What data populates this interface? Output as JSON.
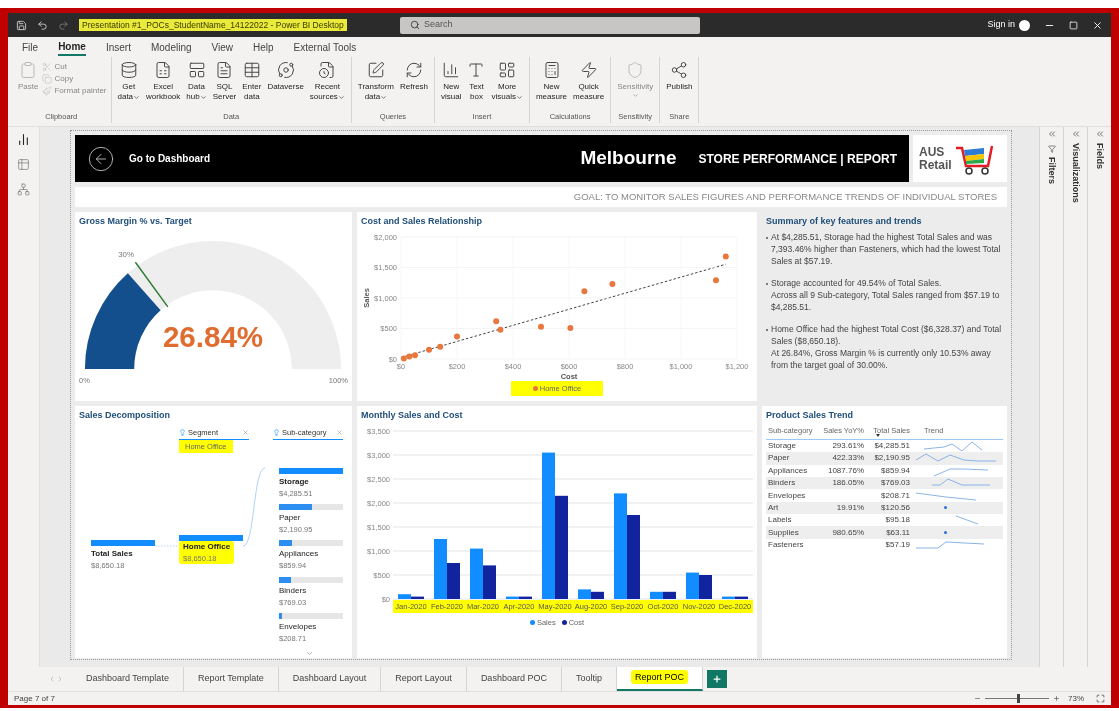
{
  "window": {
    "title": "Presentation #1_POCs_StudentName_14122022 - Power BI Desktop",
    "title_highlighted": true,
    "search": {
      "placeholder": "Search"
    },
    "sign_in": "Sign in"
  },
  "menu_tabs": [
    {
      "label": "File",
      "selected": false
    },
    {
      "label": "Home",
      "selected": true
    },
    {
      "label": "Insert",
      "selected": false
    },
    {
      "label": "Modeling",
      "selected": false
    },
    {
      "label": "View",
      "selected": false
    },
    {
      "label": "Help",
      "selected": false
    },
    {
      "label": "External Tools",
      "selected": false
    }
  ],
  "ribbon": [
    {
      "name": "Clipboard",
      "items": [
        {
          "kind": "large",
          "lines": [
            "Paste"
          ],
          "dropdown": false,
          "disabled": true
        },
        {
          "kind": "small",
          "lines": [
            "Cut"
          ],
          "dropdown": false,
          "disabled": true
        },
        {
          "kind": "small",
          "lines": [
            "Copy"
          ],
          "dropdown": false,
          "disabled": true
        },
        {
          "kind": "small",
          "lines": [
            "Format painter"
          ],
          "dropdown": false,
          "disabled": true
        }
      ]
    },
    {
      "name": "Data",
      "items": [
        {
          "kind": "large",
          "lines": [
            "Get",
            "data"
          ],
          "dropdown": true,
          "disabled": false
        },
        {
          "kind": "large",
          "lines": [
            "Excel",
            "workbook"
          ],
          "dropdown": false,
          "disabled": false
        },
        {
          "kind": "large",
          "lines": [
            "Data",
            "hub"
          ],
          "dropdown": true,
          "disabled": false
        },
        {
          "kind": "large",
          "lines": [
            "SQL",
            "Server"
          ],
          "dropdown": false,
          "disabled": false
        },
        {
          "kind": "large",
          "lines": [
            "Enter",
            "data"
          ],
          "dropdown": false,
          "disabled": false
        },
        {
          "kind": "large",
          "lines": [
            "Dataverse"
          ],
          "dropdown": false,
          "disabled": false
        },
        {
          "kind": "large",
          "lines": [
            "Recent",
            "sources"
          ],
          "dropdown": true,
          "disabled": false
        }
      ]
    },
    {
      "name": "Queries",
      "items": [
        {
          "kind": "large",
          "lines": [
            "Transform",
            "data"
          ],
          "dropdown": true,
          "disabled": false
        },
        {
          "kind": "large",
          "lines": [
            "Refresh"
          ],
          "dropdown": false,
          "disabled": false
        }
      ]
    },
    {
      "name": "Insert",
      "items": [
        {
          "kind": "large",
          "lines": [
            "New",
            "visual"
          ],
          "dropdown": false,
          "disabled": false
        },
        {
          "kind": "large",
          "lines": [
            "Text",
            "box"
          ],
          "dropdown": false,
          "disabled": false
        },
        {
          "kind": "large",
          "lines": [
            "More",
            "visuals"
          ],
          "dropdown": true,
          "disabled": false
        }
      ]
    },
    {
      "name": "Calculations",
      "items": [
        {
          "kind": "large",
          "lines": [
            "New",
            "measure"
          ],
          "dropdown": false,
          "disabled": false
        },
        {
          "kind": "large",
          "lines": [
            "Quick",
            "measure"
          ],
          "dropdown": false,
          "disabled": false
        }
      ]
    },
    {
      "name": "Sensitivity",
      "items": [
        {
          "kind": "large",
          "lines": [
            "Sensitivity"
          ],
          "dropdown": true,
          "disabled": true
        }
      ]
    },
    {
      "name": "Share",
      "items": [
        {
          "kind": "large",
          "lines": [
            "Publish"
          ],
          "dropdown": false,
          "disabled": false
        }
      ]
    }
  ],
  "left_rail": [
    {
      "selected": true
    },
    {
      "selected": false
    },
    {
      "selected": false
    }
  ],
  "header": {
    "back_label": "Go to Dashboard",
    "city": "Melbourne",
    "subtitle": "STORE PERFORMANCE | REPORT",
    "logo_lines": [
      "AUS",
      "Retail"
    ]
  },
  "goal": "GOAL: TO MONITOR SALES FIGURES AND PERFORMANCE TRENDS OF INDIVIDUAL STORES",
  "gauge": {
    "title": "Gross Margin % vs. Target",
    "value": "26.84%",
    "target_label": "30%",
    "min": "0%",
    "max": "100%"
  },
  "scatter": {
    "title": "Cost and Sales Relationship",
    "legend": {
      "highlighted": true
    },
    "chart_data": {
      "type": "scatter",
      "xlabel": "Cost",
      "ylabel": "Sales",
      "xlim": [
        0,
        1200
      ],
      "ylim": [
        0,
        2000
      ],
      "grid": true,
      "xticks": [
        {
          "value": 0,
          "label": "$0"
        },
        {
          "value": 200,
          "label": "$200"
        },
        {
          "value": 400,
          "label": "$400"
        },
        {
          "value": 600,
          "label": "$600"
        },
        {
          "value": 800,
          "label": "$800"
        },
        {
          "value": 1000,
          "label": "$1,000"
        },
        {
          "value": 1200,
          "label": "$1,200"
        }
      ],
      "yticks": [
        {
          "value": 0,
          "label": "$0"
        },
        {
          "value": 500,
          "label": "$500"
        },
        {
          "value": 1000,
          "label": "$1,000"
        },
        {
          "value": 1500,
          "label": "$1,500"
        },
        {
          "value": 2000,
          "label": "$2,000"
        }
      ],
      "x": [
        10,
        30,
        50,
        100,
        140,
        200,
        340,
        355,
        500,
        605,
        655,
        755,
        1125,
        1160
      ],
      "series": [
        {
          "name": "Home Office",
          "color": "#e8773d",
          "values": [
            10,
            40,
            60,
            150,
            200,
            370,
            620,
            480,
            530,
            510,
            1110,
            1230,
            1290,
            1680
          ]
        }
      ]
    }
  },
  "summary": {
    "title": "Summary of key features and trends",
    "bullets": [
      {
        "lines": [
          "At $4,285.51, Storage had the highest Total Sales and was 7,393.46% higher than Fasteners, which had the lowest Total Sales at $57.19."
        ]
      },
      {
        "lines": [
          "Storage accounted for 49.54% of Total Sales.",
          "Across all 9 Sub-category, Total Sales ranged from $57.19 to $4,285.51."
        ]
      },
      {
        "lines": [
          "Home Office had the highest Total Cost ($6,328.37) and Total Sales ($8,650.18).",
          "At 26.84%, Gross Margin % is currently only 10.53% away from the target goal of 30.00%."
        ]
      }
    ]
  },
  "decomposition": {
    "title": "Sales Decomposition",
    "levels": [
      {
        "label": "Segment",
        "filter": "Home Office",
        "highlighted": true
      },
      {
        "label": "Sub-category"
      }
    ],
    "root": {
      "label": "Total Sales",
      "value": "$8,650.18",
      "level": 1
    },
    "segment": {
      "label": "Home Office",
      "value": "$8,650.18",
      "level": 1,
      "selected": true,
      "highlighted": true
    },
    "children": [
      {
        "label": "Storage",
        "value": "$4,285.51",
        "level": 1,
        "selected": true
      },
      {
        "label": "Paper",
        "value": "$2,190.95",
        "level": 0.51,
        "selected": false
      },
      {
        "label": "Appliances",
        "value": "$859.94",
        "level": 0.2,
        "selected": false
      },
      {
        "label": "Binders",
        "value": "$769.03",
        "level": 0.18,
        "selected": false
      },
      {
        "label": "Envelopes",
        "value": "$208.71",
        "level": 0.05,
        "selected": false
      }
    ]
  },
  "monthly": {
    "title": "Monthly Sales and Cost",
    "axis_highlighted": true,
    "chart_data": {
      "type": "bar",
      "categories": [
        "Jan-2020",
        "Feb-2020",
        "Mar-2020",
        "Apr-2020",
        "May-2020",
        "Aug-2020",
        "Sep-2020",
        "Oct-2020",
        "Nov-2020",
        "Dec-2020"
      ],
      "ylim": [
        0,
        3500
      ],
      "grid": true,
      "yticks": [
        {
          "value": 0,
          "label": "$0"
        },
        {
          "value": 500,
          "label": "$500"
        },
        {
          "value": 1000,
          "label": "$1,000"
        },
        {
          "value": 1500,
          "label": "$1,500"
        },
        {
          "value": 2000,
          "label": "$2,000"
        },
        {
          "value": 2500,
          "label": "$2,500"
        },
        {
          "value": 3000,
          "label": "$3,000"
        },
        {
          "value": 3500,
          "label": "$3,500"
        }
      ],
      "series": [
        {
          "name": "Sales",
          "color": "#118dff",
          "values": [
            100,
            1250,
            1050,
            50,
            3050,
            200,
            2200,
            150,
            550,
            50
          ]
        },
        {
          "name": "Cost",
          "color": "#12239e",
          "values": [
            50,
            750,
            700,
            50,
            2150,
            150,
            1750,
            150,
            500,
            50
          ]
        }
      ]
    }
  },
  "product_table": {
    "title": "Product Sales Trend",
    "columns": [
      {
        "label": "Sub-category",
        "sorted": false
      },
      {
        "label": "Sales YoY%",
        "sorted": false
      },
      {
        "label": "Total Sales",
        "sorted": true
      },
      {
        "label": "Trend",
        "sorted": false
      }
    ],
    "rows": [
      {
        "cells": [
          "Storage",
          "293.61%",
          "$4,285.51"
        ],
        "kind": "line"
      },
      {
        "cells": [
          "Paper",
          "422.33%",
          "$2,190.95"
        ],
        "kind": "line"
      },
      {
        "cells": [
          "Appliances",
          "1087.76%",
          "$859.94"
        ],
        "kind": "line"
      },
      {
        "cells": [
          "Binders",
          "186.05%",
          "$769.03"
        ],
        "kind": "line"
      },
      {
        "cells": [
          "Envelopes",
          "",
          "$208.71"
        ],
        "kind": "line"
      },
      {
        "cells": [
          "Art",
          "19.91%",
          "$120.56"
        ],
        "kind": "dot"
      },
      {
        "cells": [
          "Labels",
          "",
          "$95.18"
        ],
        "kind": "line"
      },
      {
        "cells": [
          "Supplies",
          "980.65%",
          "$63.11"
        ],
        "kind": "dot"
      },
      {
        "cells": [
          "Fasteners",
          "",
          "$57.19"
        ],
        "kind": "line"
      }
    ]
  },
  "panes": [
    {
      "label": "Filters",
      "kind": "filters"
    },
    {
      "label": "Visualizations",
      "kind": "plain"
    },
    {
      "label": "Fields",
      "kind": "plain"
    }
  ],
  "page_tabs": [
    {
      "label": "Dashboard Template",
      "selected": false,
      "highlighted": false
    },
    {
      "label": "Report Template",
      "selected": false,
      "highlighted": false
    },
    {
      "label": "Dashboard Layout",
      "selected": false,
      "highlighted": false
    },
    {
      "label": "Report Layout",
      "selected": false,
      "highlighted": false
    },
    {
      "label": "Dashboard POC",
      "selected": false,
      "highlighted": false
    },
    {
      "label": "Tooltip",
      "selected": false,
      "highlighted": false
    },
    {
      "label": "Report POC",
      "selected": true,
      "highlighted": true
    }
  ],
  "status_bar": {
    "page": "Page 7 of 7",
    "zoom": {
      "level": 0.5,
      "reading": "73%"
    }
  }
}
